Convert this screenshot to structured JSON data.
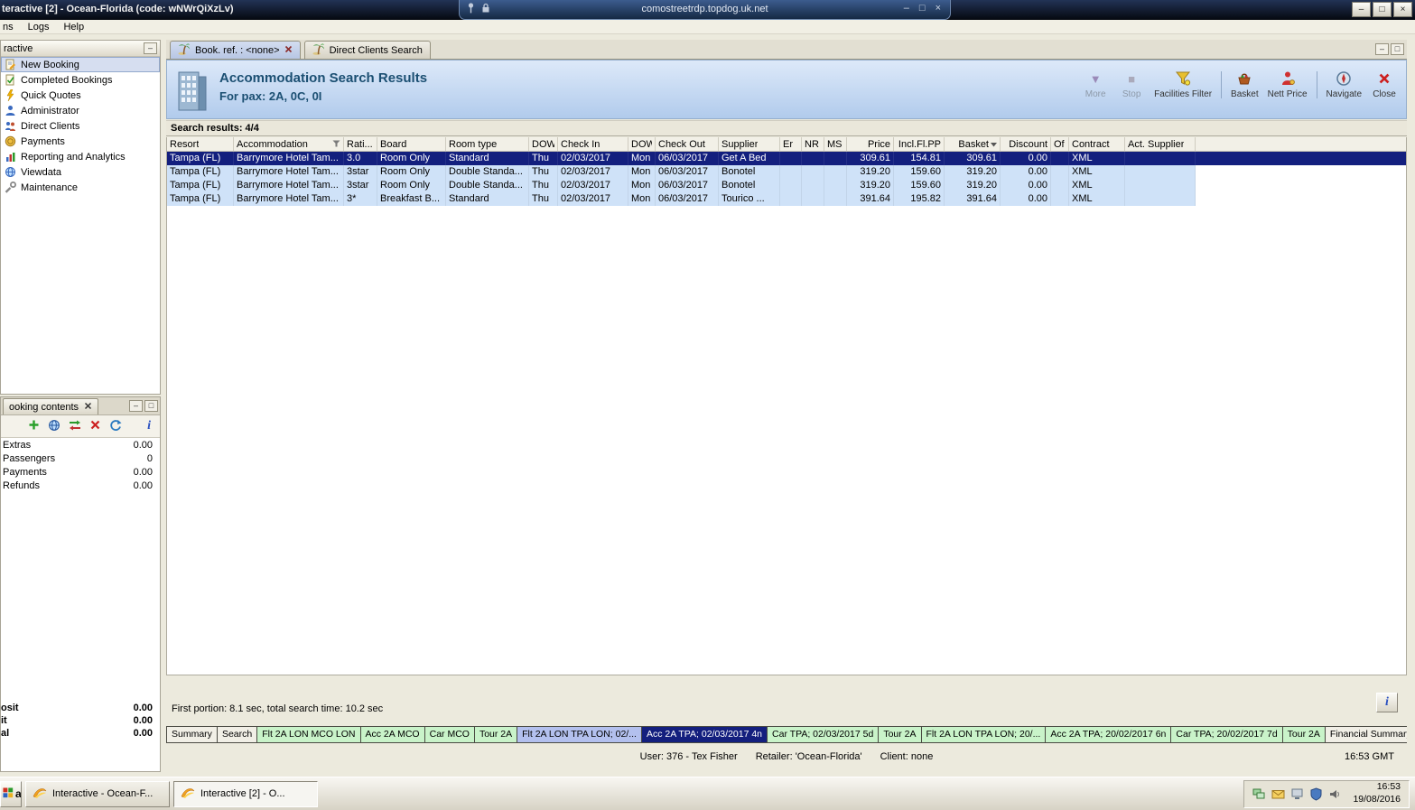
{
  "colors": {
    "selection_row": "#131f7e",
    "result_row": "#cfe2f8",
    "header_gradient_top": "#dde9f9",
    "header_gradient_bottom": "#b1cbec",
    "portion_green": "#c9f3c9",
    "portion_blue": "#b3c0ee",
    "portion_selected": "#131f7e",
    "title_text": "#1b4f72"
  },
  "icons": {
    "minimize": "–",
    "restore": "□",
    "close": "×",
    "more": "▼",
    "stop": "■",
    "sort": "▼",
    "info": "i"
  },
  "top_bar": {
    "window_title": "teractive [2] - Ocean-Florida (code: wNWrQiXzLv)",
    "rdp_address": "comostreetrdp.topdog.uk.net"
  },
  "menu_bar": {
    "items": [
      "ns",
      "Logs",
      "Help"
    ]
  },
  "sidebar": {
    "title": "ractive",
    "items": [
      {
        "label": "New Booking"
      },
      {
        "label": "Completed Bookings"
      },
      {
        "label": "Quick Quotes"
      },
      {
        "label": "Administrator"
      },
      {
        "label": "Direct Clients"
      },
      {
        "label": "Payments"
      },
      {
        "label": "Reporting and Analytics"
      },
      {
        "label": "Viewdata"
      },
      {
        "label": "Maintenance"
      }
    ]
  },
  "booking_contents": {
    "title": "ooking contents",
    "rows": [
      {
        "label": "Extras",
        "value": "0.00"
      },
      {
        "label": "Passengers",
        "value": "0"
      },
      {
        "label": "Payments",
        "value": "0.00"
      },
      {
        "label": "Refunds",
        "value": "0.00"
      }
    ],
    "totals": [
      {
        "label": "osit",
        "value": "0.00"
      },
      {
        "label": "it",
        "value": "0.00"
      },
      {
        "label": "al",
        "value": "0.00"
      }
    ]
  },
  "doc_tabs": [
    {
      "label": "Book. ref. : <none>",
      "active": true
    },
    {
      "label": "Direct Clients Search",
      "active": false
    }
  ],
  "header": {
    "title": "Accommodation Search Results",
    "subtitle": "For pax: 2A, 0C, 0I",
    "buttons": [
      {
        "label": "More",
        "disabled": true
      },
      {
        "label": "Stop",
        "disabled": true
      },
      {
        "label": "Facilities Filter",
        "disabled": false
      },
      {
        "label": "Basket",
        "disabled": false
      },
      {
        "label": "Nett Price",
        "disabled": false
      },
      {
        "label": "Navigate",
        "disabled": false
      },
      {
        "label": "Close",
        "disabled": false
      }
    ]
  },
  "results": {
    "summary": "Search results: 4/4",
    "columns": [
      "Resort",
      "Accommodation",
      "Rati...",
      "Board",
      "Room type",
      "DOW",
      "Check In",
      "DOW",
      "Check Out",
      "Supplier",
      "Er",
      "NR",
      "MS",
      "Price",
      "Incl.Fl.PP",
      "Basket",
      "Discount",
      "Of",
      "Contract",
      "Act. Supplier"
    ],
    "rows": [
      {
        "state": "selected",
        "cells": [
          "Tampa (FL)",
          "Barrymore Hotel Tam...",
          "3.0",
          "Room Only",
          "Standard",
          "Thu",
          "02/03/2017",
          "Mon",
          "06/03/2017",
          "Get A Bed",
          "",
          "",
          "",
          "309.61",
          "154.81",
          "309.61",
          "0.00",
          "",
          "XML",
          ""
        ]
      },
      {
        "state": "normal",
        "cells": [
          "Tampa (FL)",
          "Barrymore Hotel Tam...",
          "3star",
          "Room Only",
          "Double Standa...",
          "Thu",
          "02/03/2017",
          "Mon",
          "06/03/2017",
          "Bonotel",
          "",
          "",
          "",
          "319.20",
          "159.60",
          "319.20",
          "0.00",
          "",
          "XML",
          ""
        ]
      },
      {
        "state": "normal",
        "cells": [
          "Tampa (FL)",
          "Barrymore Hotel Tam...",
          "3star",
          "Room Only",
          "Double Standa...",
          "Thu",
          "02/03/2017",
          "Mon",
          "06/03/2017",
          "Bonotel",
          "",
          "",
          "",
          "319.20",
          "159.60",
          "319.20",
          "0.00",
          "",
          "XML",
          ""
        ]
      },
      {
        "state": "normal",
        "cells": [
          "Tampa (FL)",
          "Barrymore Hotel Tam...",
          "3*",
          "Breakfast B...",
          "Standard",
          "Thu",
          "02/03/2017",
          "Mon",
          "06/03/2017",
          "Tourico ...",
          "",
          "",
          "",
          "391.64",
          "195.82",
          "391.64",
          "0.00",
          "",
          "XML",
          ""
        ]
      }
    ]
  },
  "status_line": "First portion: 8.1 sec, total search time: 10.2 sec",
  "portions": [
    {
      "label": "Summary",
      "state": "plain"
    },
    {
      "label": "Search",
      "state": "plain"
    },
    {
      "label": "Flt 2A LON MCO LON",
      "state": "green"
    },
    {
      "label": "Acc 2A MCO",
      "state": "green"
    },
    {
      "label": "Car MCO",
      "state": "green"
    },
    {
      "label": "Tour 2A",
      "state": "green"
    },
    {
      "label": "Flt 2A LON TPA LON; 02/...",
      "state": "blue"
    },
    {
      "label": "Acc 2A TPA; 02/03/2017 4n",
      "state": "selected"
    },
    {
      "label": "Car TPA; 02/03/2017 5d",
      "state": "green"
    },
    {
      "label": "Tour 2A",
      "state": "green"
    },
    {
      "label": "Flt 2A LON TPA LON; 20/...",
      "state": "green"
    },
    {
      "label": "Acc 2A TPA; 20/02/2017 6n",
      "state": "green"
    },
    {
      "label": "Car TPA; 20/02/2017 7d",
      "state": "green"
    },
    {
      "label": "Tour 2A",
      "state": "green"
    },
    {
      "label": "Financial Summary",
      "state": "plain"
    }
  ],
  "status_bar": {
    "user": "User: 376 - Tex Fisher",
    "retailer": "Retailer: 'Ocean-Florida'",
    "client": "Client: none",
    "time": "16:53 GMT"
  },
  "taskbar": {
    "start_label": "art",
    "buttons": [
      {
        "label": "Interactive - Ocean-F...",
        "active": false
      },
      {
        "label": "Interactive [2] - O...",
        "active": true
      }
    ],
    "clock_time": "16:53",
    "clock_date": "19/08/2016"
  }
}
